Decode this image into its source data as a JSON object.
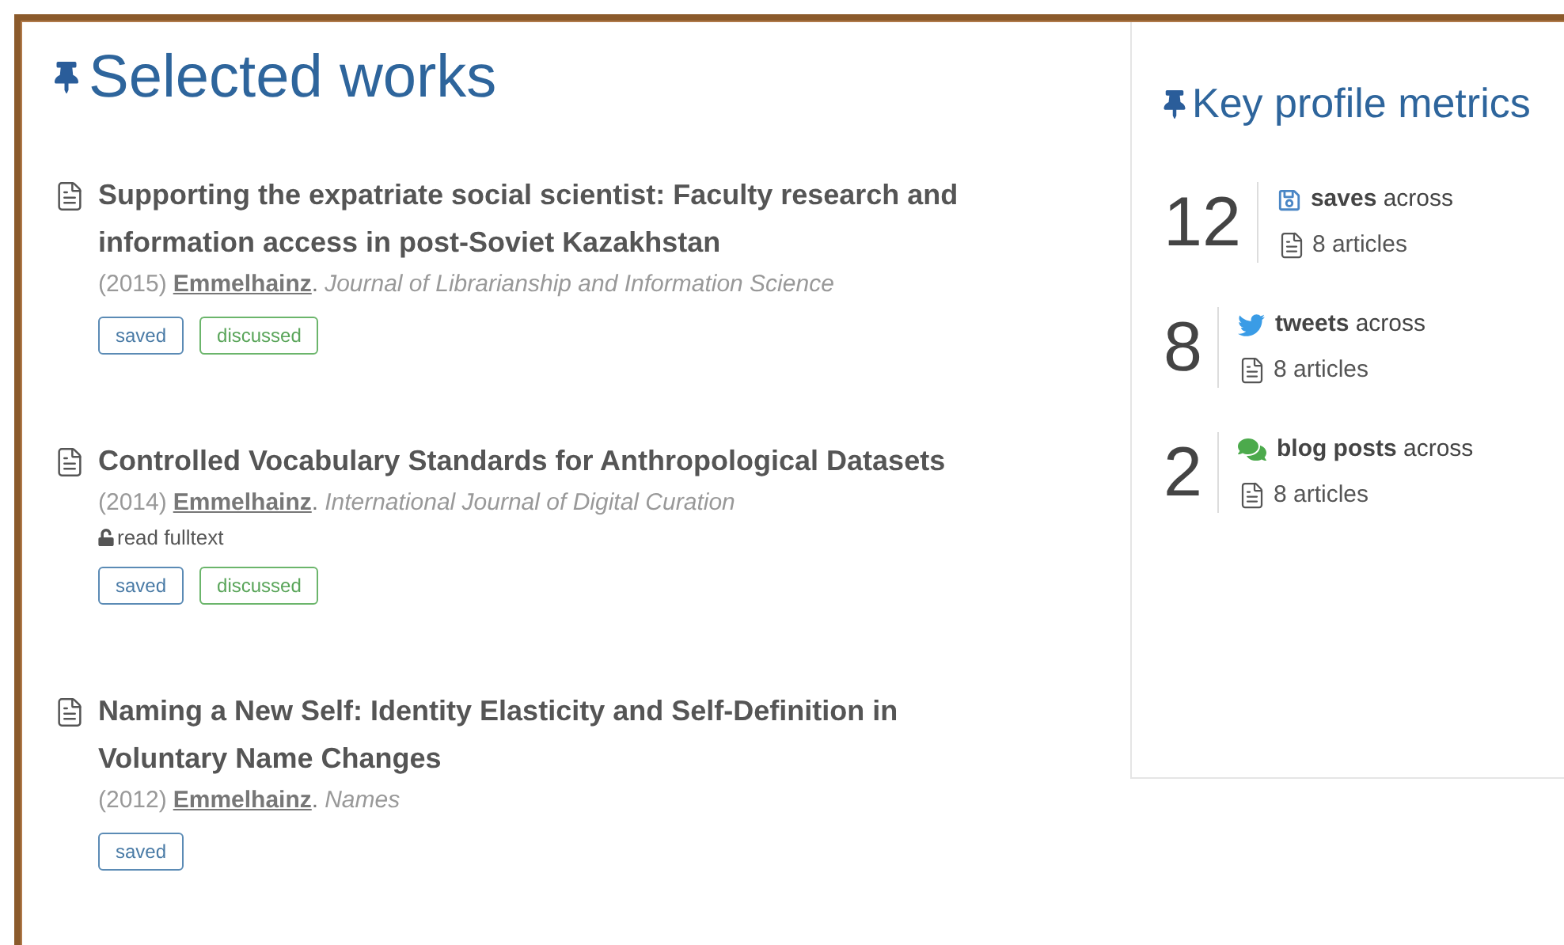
{
  "works_section": {
    "title": "Selected works",
    "works": [
      {
        "title": "Supporting the expatriate social scientist: Faculty research and information access in post-Soviet Kazakhstan",
        "year": "(2015)",
        "author": "Emmelhainz",
        "separator": ".",
        "journal": "Journal of Librarianship and Information Science",
        "tags": [
          {
            "label": "saved",
            "kind": "saved"
          },
          {
            "label": "discussed",
            "kind": "discussed"
          }
        ]
      },
      {
        "title": "Controlled Vocabulary Standards for Anthropological Datasets",
        "year": "(2014)",
        "author": "Emmelhainz",
        "separator": ".",
        "journal": "International Journal of Digital Curation",
        "fulltext": "read fulltext",
        "tags": [
          {
            "label": "saved",
            "kind": "saved"
          },
          {
            "label": "discussed",
            "kind": "discussed"
          }
        ]
      },
      {
        "title": "Naming a New Self: Identity Elasticity and Self-Definition in Voluntary Name Changes",
        "year": "(2012)",
        "author": "Emmelhainz",
        "separator": ".",
        "journal": "Names",
        "tags": [
          {
            "label": "saved",
            "kind": "saved"
          }
        ]
      }
    ]
  },
  "metrics_panel": {
    "title": "Key profile metrics",
    "metrics": [
      {
        "count": "12",
        "kind": "saves",
        "label": "**saves** across",
        "articles": "8 articles"
      },
      {
        "count": "8",
        "kind": "tweets",
        "label": "**tweets** across",
        "articles": "8 articles"
      },
      {
        "count": "2",
        "kind": "blog",
        "label": "**blog posts** across",
        "articles": "8 articles"
      }
    ]
  }
}
